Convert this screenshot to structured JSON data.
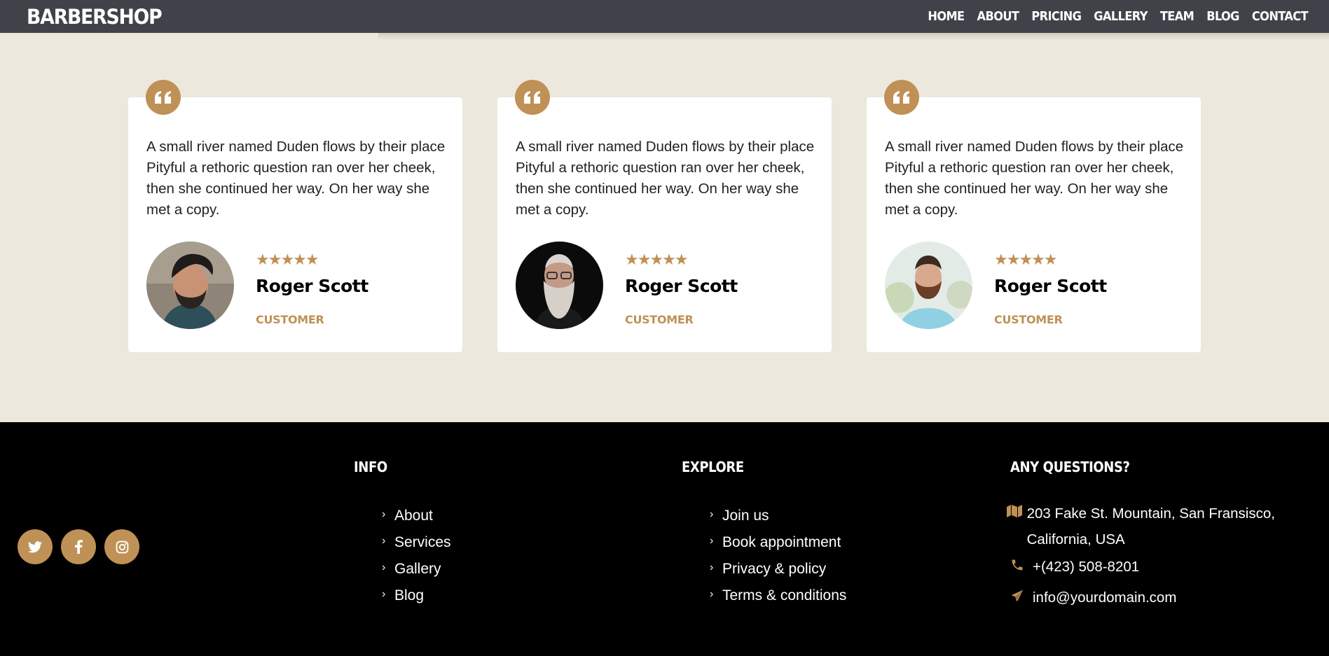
{
  "nav": {
    "brand": "BARBERSHOP",
    "links": [
      "HOME",
      "ABOUT",
      "PRICING",
      "GALLERY",
      "TEAM",
      "BLOG",
      "CONTACT"
    ]
  },
  "testimonials": [
    {
      "quote": "A small river named Duden flows by their place Pityful a rethoric question ran over her cheek, then she continued her way. On her way she met a copy.",
      "stars": "★★★★★",
      "rating": 5,
      "name": "Roger Scott",
      "role": "CUSTOMER"
    },
    {
      "quote": "A small river named Duden flows by their place Pityful a rethoric question ran over her cheek, then she continued her way. On her way she met a copy.",
      "stars": "★★★★★",
      "rating": 5,
      "name": "Roger Scott",
      "role": "CUSTOMER"
    },
    {
      "quote": "A small river named Duden flows by their place Pityful a rethoric question ran over her cheek, then she continued her way. On her way she met a copy.",
      "stars": "★★★★★",
      "rating": 5,
      "name": "Roger Scott",
      "role": "CUSTOMER"
    }
  ],
  "footer": {
    "social_icons": [
      "twitter-icon",
      "facebook-icon",
      "instagram-icon"
    ],
    "info": {
      "title": "INFO",
      "links": [
        "About",
        "Services",
        "Gallery",
        "Blog"
      ]
    },
    "explore": {
      "title": "EXPLORE",
      "links": [
        "Join us",
        "Book appointment",
        "Privacy & policy",
        "Terms & conditions"
      ]
    },
    "questions": {
      "title": "ANY QUESTIONS?",
      "address": "203 Fake St. Mountain, San Fransisco, California, USA",
      "phone": "+(423) 508-8201",
      "email": "info@yourdomain.com"
    }
  },
  "colors": {
    "accent": "#bf9156",
    "navbar": "#3f4349",
    "section_bg": "#ece8dd",
    "footer_bg": "#000000"
  }
}
